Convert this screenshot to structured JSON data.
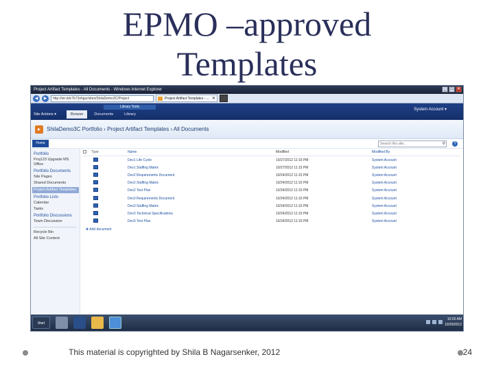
{
  "slide": {
    "title_line1": "EPMO –approved",
    "title_line2": "Templates",
    "footer": "This material is copyrighted by Shila B Nagarsenker, 2012",
    "page_number": "24"
  },
  "browser": {
    "title": "Project Artifact Templates - All Documents - Windows Internet Explorer",
    "address": "http://wt-ddc7b73ohjpz/sites/ShilaDemo3C/Project",
    "tab_label": "Project Artifact Templates - ...",
    "win_min": "_",
    "win_max": "□",
    "win_close": "✕",
    "back": "◀",
    "forward": "▶",
    "tab_close": "✕"
  },
  "ribbon": {
    "site_actions": "Site Actions ▾",
    "tools_label": "Library Tools",
    "tabs": [
      "Browse",
      "Documents",
      "Library"
    ],
    "user": "System Account ▾"
  },
  "header": {
    "breadcrumb": [
      "ShilaDemo3C Portfolio",
      "Project Artifact Templates",
      "All Documents"
    ],
    "separator": "›",
    "logo_glyph": "▸"
  },
  "search": {
    "home_label": "Home",
    "placeholder": "Search this site...",
    "search_glyph": "⚲",
    "help_glyph": "?"
  },
  "quicklaunch": {
    "sections": [
      {
        "heading": "Portfolio",
        "items": [
          "Proj123 Upgrade MS Office"
        ]
      },
      {
        "heading": "Portfolio Documents",
        "items": [
          "Site Pages",
          "Shared Documents",
          "Project Artifact Templates"
        ]
      },
      {
        "heading": "Portfolio Lists",
        "items": [
          "Calendar",
          "Tasks"
        ]
      },
      {
        "heading": "Portfolio Discussions",
        "items": [
          "Team Discussion"
        ]
      }
    ],
    "bottom_items": [
      "Recycle Bin",
      "All Site Content"
    ]
  },
  "doclist": {
    "columns": [
      "Type",
      "Name",
      "Modified",
      "Modified By"
    ],
    "rows": [
      {
        "name": "Dev1 Life Cycle",
        "modified": "10/27/2012 11:15 PM",
        "by": "System Account"
      },
      {
        "name": "Dev1 Staffing Matrix",
        "modified": "10/27/2012 11:15 PM",
        "by": "System Account"
      },
      {
        "name": "Dev2 Requirements Document",
        "modified": "10/24/2012 11:15 PM",
        "by": "System Account"
      },
      {
        "name": "Dev2 Staffing Matrix",
        "modified": "10/24/2012 11:15 PM",
        "by": "System Account"
      },
      {
        "name": "Dev2 Test Plan",
        "modified": "10/24/2012 11:15 PM",
        "by": "System Account"
      },
      {
        "name": "Dev3 Requirements Document",
        "modified": "10/24/2012 11:15 PM",
        "by": "System Account"
      },
      {
        "name": "Dev3 Staffing Matrix",
        "modified": "10/24/2012 11:15 PM",
        "by": "System Account"
      },
      {
        "name": "Dev3 Technical Specifications",
        "modified": "10/24/2012 11:15 PM",
        "by": "System Account"
      },
      {
        "name": "Dev3 Test Plan",
        "modified": "10/24/2012 11:15 PM",
        "by": "System Account"
      }
    ],
    "add_document": "✚ Add document"
  },
  "taskbar": {
    "start": "Start",
    "time": "10:26 AM",
    "date": "10/29/2012"
  }
}
